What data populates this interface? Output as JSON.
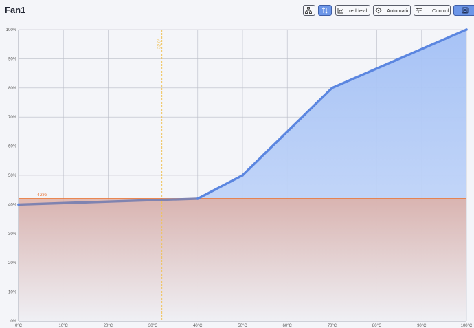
{
  "header": {
    "title": "Fan1",
    "buttons": [
      {
        "name": "hierarchy-button",
        "icon": "hierarchy-icon",
        "label": ""
      },
      {
        "name": "sort-toggle-button",
        "icon": "sort-arrows-icon",
        "label": "",
        "active": true
      },
      {
        "name": "sensor-select-button",
        "icon": "chart-line-icon",
        "label": "reddevil"
      },
      {
        "name": "mode-select-button",
        "icon": "gear-icon",
        "label": "Automatic"
      },
      {
        "name": "control-button",
        "icon": "sliders-icon",
        "label": "Control"
      },
      {
        "name": "apply-button",
        "icon": "save-icon",
        "label": "",
        "active": true
      }
    ]
  },
  "chart_data": {
    "type": "area",
    "x_unit": "°C",
    "y_unit": "%",
    "xlim": [
      0,
      100
    ],
    "ylim": [
      0,
      100
    ],
    "x_ticks": [
      "0°C",
      "10°C",
      "20°C",
      "30°C",
      "40°C",
      "50°C",
      "60°C",
      "70°C",
      "80°C",
      "90°C",
      "100°C"
    ],
    "y_ticks": [
      "0%",
      "10%",
      "20%",
      "30%",
      "40%",
      "50%",
      "60%",
      "70%",
      "80%",
      "90%",
      "100%"
    ],
    "grid": true,
    "curve": {
      "x": [
        0,
        40,
        50,
        70,
        100
      ],
      "y": [
        40,
        42,
        50,
        80,
        100
      ],
      "color": "#5b86e0"
    },
    "current_duty": {
      "value": 42,
      "label": "42%",
      "color": "#e8773a"
    },
    "current_temp": {
      "value": 32,
      "label": "32.0°",
      "color": "#f0c35a"
    }
  }
}
